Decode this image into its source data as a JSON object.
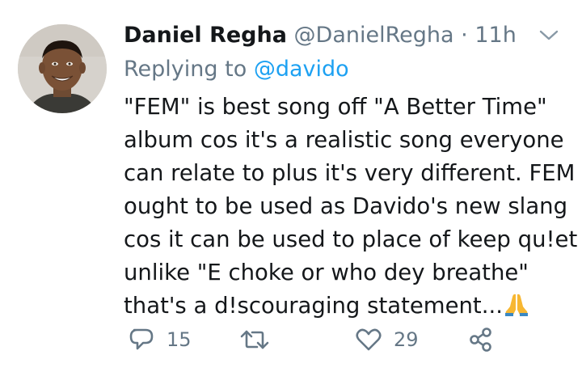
{
  "tweet": {
    "author_name": "Daniel Regha",
    "author_handle": "@DanielRegha",
    "separator": "·",
    "timestamp": "11h",
    "replying_to_label": "Replying to",
    "replying_to_handle": "@davido",
    "body_lines": [
      "\"FEM\" is best song off \"A Better Time\"",
      "album cos it's a realistic song everyone",
      "can relate to plus it's very different. FEM",
      "ought to be used as Davido's new slang",
      "cos it can be used to place of keep qu!et",
      "unlike \"E choke or who dey breathe\"",
      "that's a d!scouraging statement..."
    ],
    "body_emoji": "folded-hands-emoji"
  },
  "actions": {
    "reply_count": "15",
    "retweet_count": "",
    "like_count": "29",
    "share_count": ""
  },
  "icons": {
    "reply": "reply-icon",
    "retweet": "retweet-icon",
    "like": "heart-icon",
    "share": "share-icon",
    "caret": "chevron-down-icon"
  },
  "colors": {
    "text": "#14171a",
    "secondary": "#657786",
    "link": "#1da1f2"
  }
}
